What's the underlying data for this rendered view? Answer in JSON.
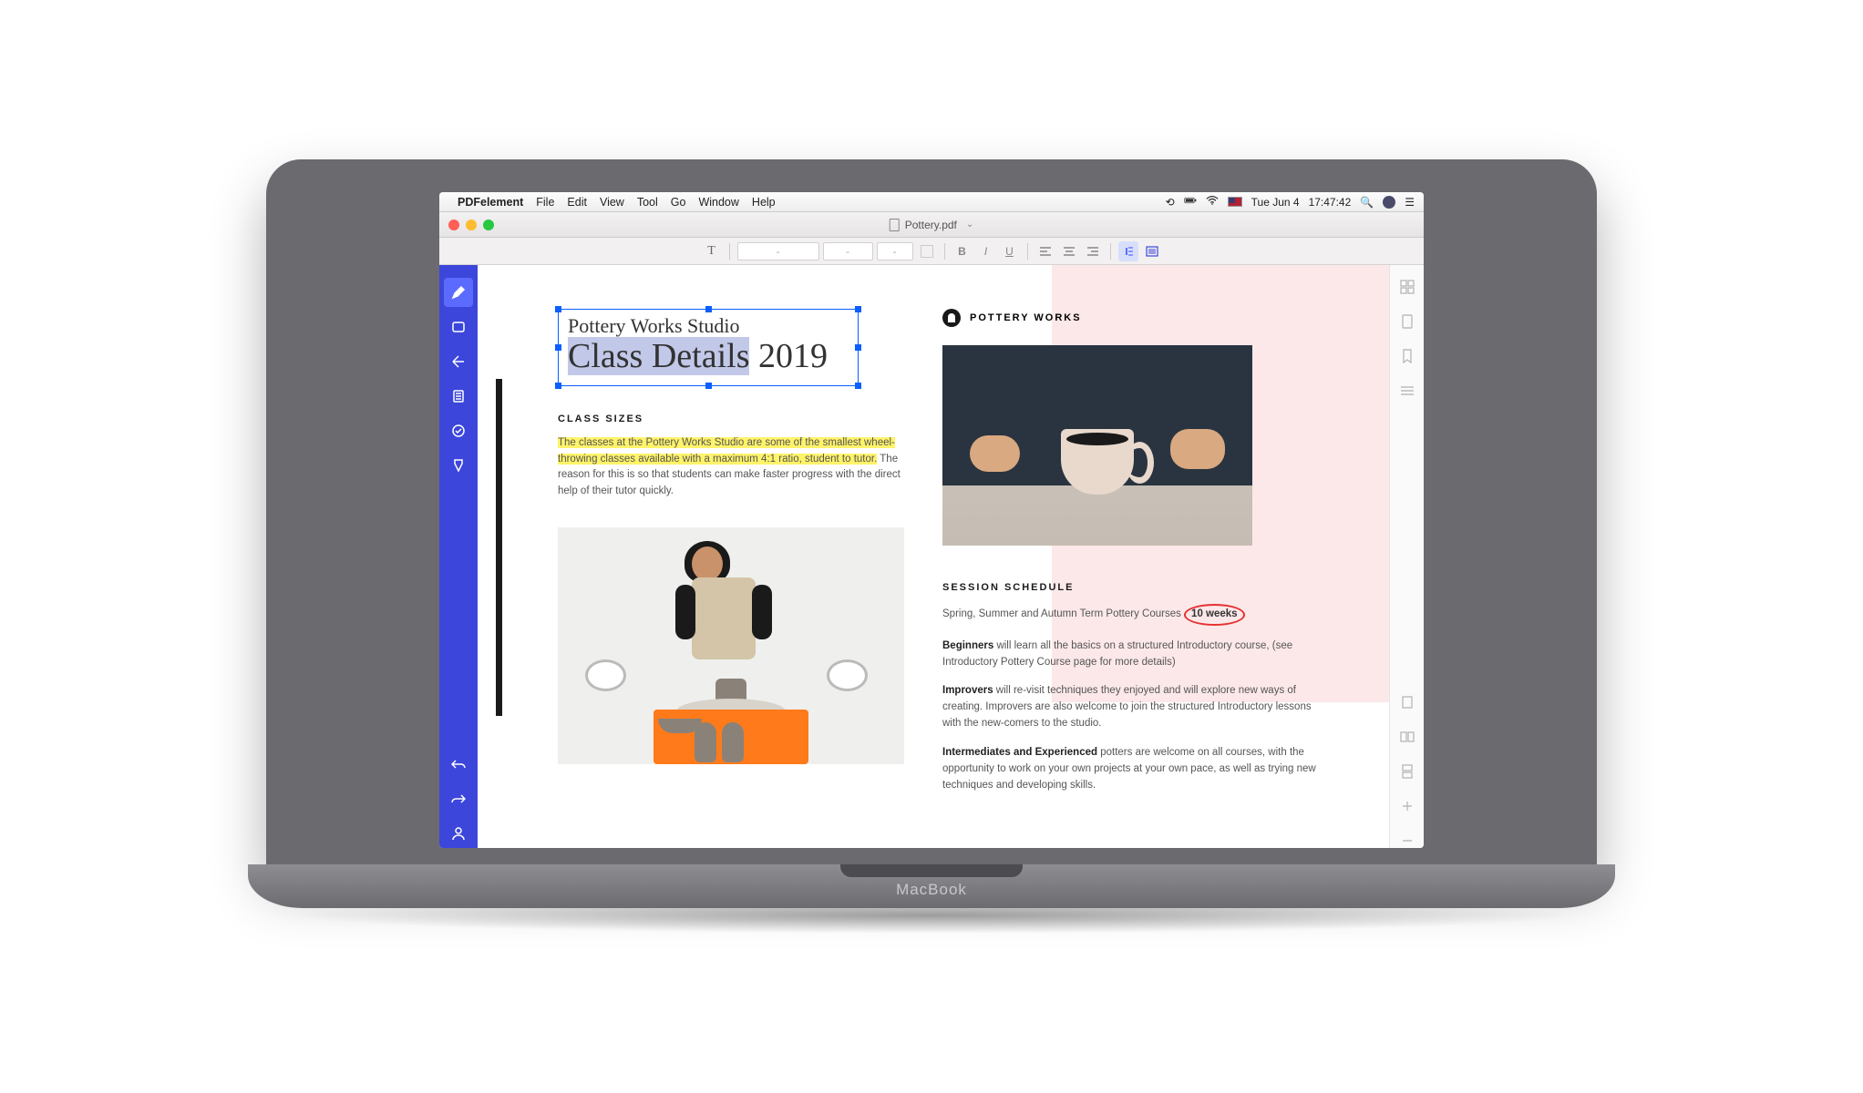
{
  "menubar": {
    "app": "PDFelement",
    "items": [
      "File",
      "Edit",
      "View",
      "Tool",
      "Go",
      "Window",
      "Help"
    ],
    "right": {
      "date": "Tue Jun 4",
      "time": "17:47:42"
    }
  },
  "window": {
    "title": "Pottery.pdf"
  },
  "formatbar": {
    "text_tool": "T",
    "dash": "-"
  },
  "doc": {
    "subtitle": "Pottery Works Studio",
    "title_highlighted": "Class Details",
    "title_year": " 2019",
    "section1_head": "CLASS SIZES",
    "para1_highlight": "The classes at the Pottery Works Studio are some of the smallest wheel-throwing classes available with a maximum 4:1 ratio, student to tutor.",
    "para1_rest": " The reason for this is so that students can make faster progress with the direct help of their tutor quickly.",
    "logo_text": "POTTERY WORKS",
    "section2_head": "SESSION SCHEDULE",
    "sched_intro": "Spring, Summer and Autumn Term Pottery Courses ",
    "sched_circled": "10 weeks",
    "beg_bold": "Beginners",
    "beg_text": " will learn all the basics on a structured Introductory course, (see Introductory Pottery Course page for more details)",
    "imp_bold": "Improvers",
    "imp_text": " will re-visit techniques they enjoyed and will explore new ways of creating. Improvers are also welcome to join the structured Introductory lessons with the new-comers to the studio.",
    "int_bold": "Intermediates and Experienced",
    "int_text": " potters are welcome on all courses, with the opportunity to work on your own projects at your own pace, as well as trying new techniques and developing skills."
  },
  "laptop": {
    "brand": "MacBook"
  }
}
